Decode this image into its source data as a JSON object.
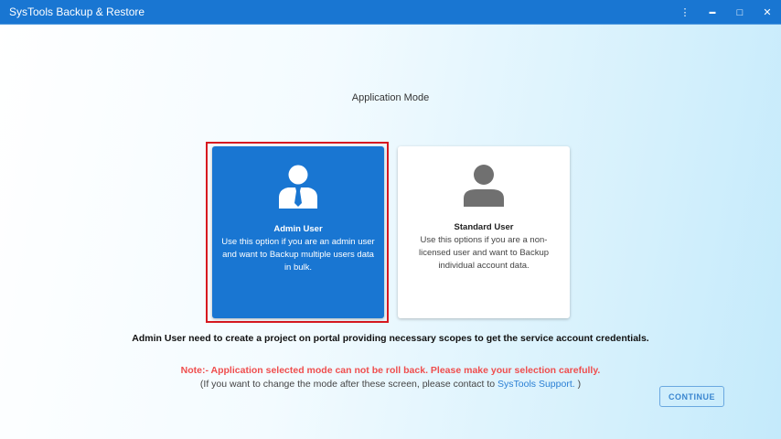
{
  "window": {
    "title": "SysTools Backup & Restore",
    "menu_icon": "⋮",
    "minimize_icon": "▬",
    "maximize_icon": "□",
    "close_icon": "✕"
  },
  "main": {
    "heading": "Application Mode",
    "cards": [
      {
        "title": "Admin User",
        "description": "Use this option if you are an admin user and want to Backup multiple users data in bulk.",
        "selected": true
      },
      {
        "title": "Standard User",
        "description": "Use this options if you are a non-licensed user and want to Backup individual account data.",
        "selected": false
      }
    ],
    "info": "Admin User need to create a project on portal providing necessary scopes to get the service account credentials.",
    "note": "Note:- Application selected mode can not be roll back. Please make your selection carefully.",
    "contact_prefix": "(If you want to change the mode after these screen, please contact to ",
    "contact_link": "SysTools Support.",
    "contact_suffix": " )",
    "continue_label": "CONTINUE"
  },
  "colors": {
    "accent": "#1976d2",
    "selection": "#d71920",
    "note": "#ef4e4e"
  }
}
